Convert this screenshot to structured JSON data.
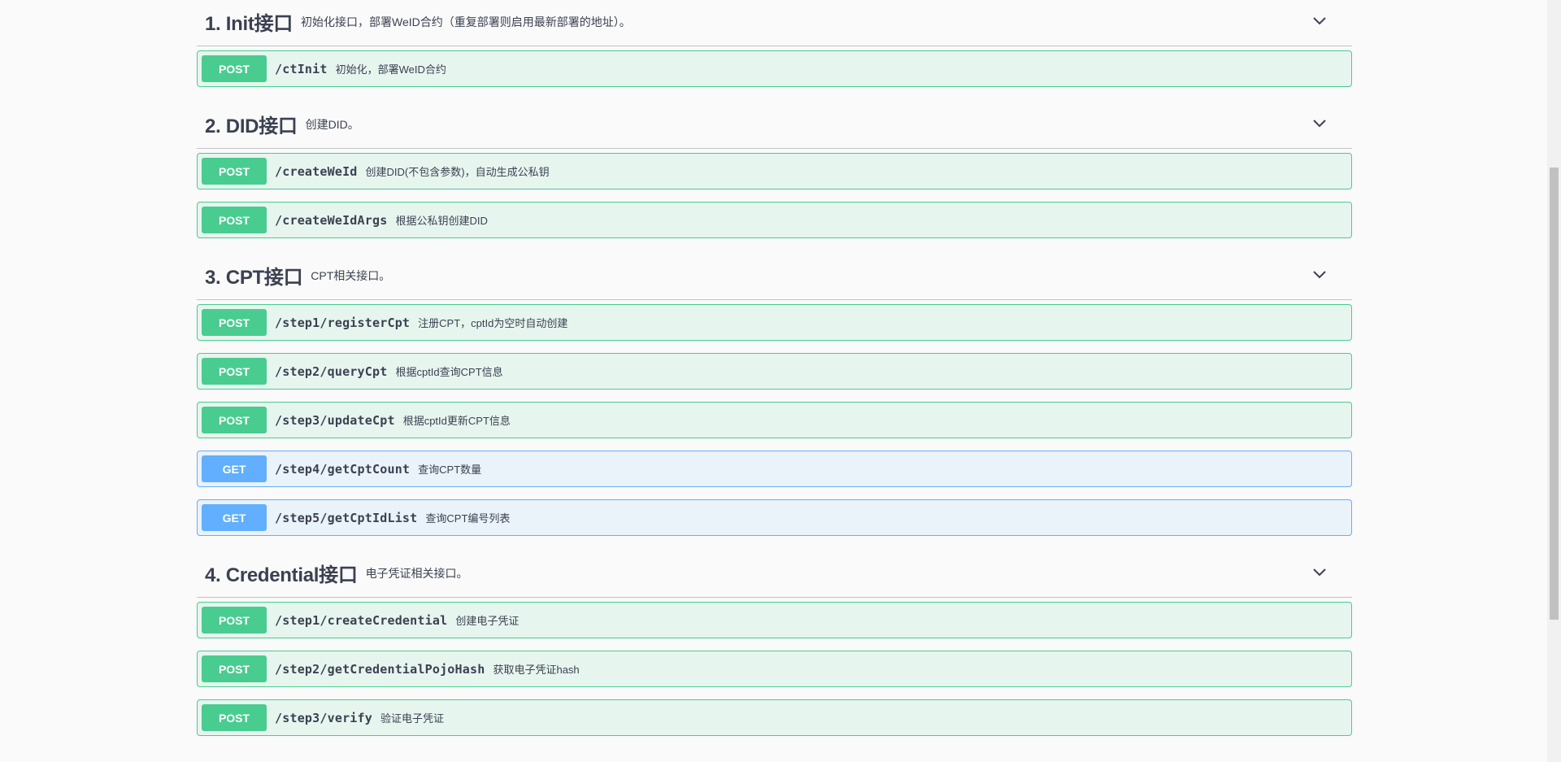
{
  "sections": [
    {
      "name": "1. Init接口",
      "description": "初始化接口，部署WeID合约（重复部署则启用最新部署的地址）。",
      "operations": [
        {
          "method": "POST",
          "path": "/ctInit",
          "summary": "初始化，部署WeID合约"
        }
      ]
    },
    {
      "name": "2. DID接口",
      "description": "创建DID。",
      "operations": [
        {
          "method": "POST",
          "path": "/createWeId",
          "summary": "创建DID(不包含参数)，自动生成公私钥"
        },
        {
          "method": "POST",
          "path": "/createWeIdArgs",
          "summary": "根据公私钥创建DID"
        }
      ]
    },
    {
      "name": "3. CPT接口",
      "description": "CPT相关接口。",
      "operations": [
        {
          "method": "POST",
          "path": "/step1/registerCpt",
          "summary": "注册CPT，cptId为空时自动创建"
        },
        {
          "method": "POST",
          "path": "/step2/queryCpt",
          "summary": "根据cptId查询CPT信息"
        },
        {
          "method": "POST",
          "path": "/step3/updateCpt",
          "summary": "根据cptId更新CPT信息"
        },
        {
          "method": "GET",
          "path": "/step4/getCptCount",
          "summary": "查询CPT数量"
        },
        {
          "method": "GET",
          "path": "/step5/getCptIdList",
          "summary": "查询CPT编号列表"
        }
      ]
    },
    {
      "name": "4. Credential接口",
      "description": "电子凭证相关接口。",
      "operations": [
        {
          "method": "POST",
          "path": "/step1/createCredential",
          "summary": "创建电子凭证"
        },
        {
          "method": "POST",
          "path": "/step2/getCredentialPojoHash",
          "summary": "获取电子凭证hash"
        },
        {
          "method": "POST",
          "path": "/step3/verify",
          "summary": "验证电子凭证"
        }
      ]
    }
  ],
  "icons": {
    "expand": "chevron-down-icon"
  },
  "colors": {
    "post": "#49cc90",
    "get": "#61affe",
    "text": "#3b4151"
  }
}
